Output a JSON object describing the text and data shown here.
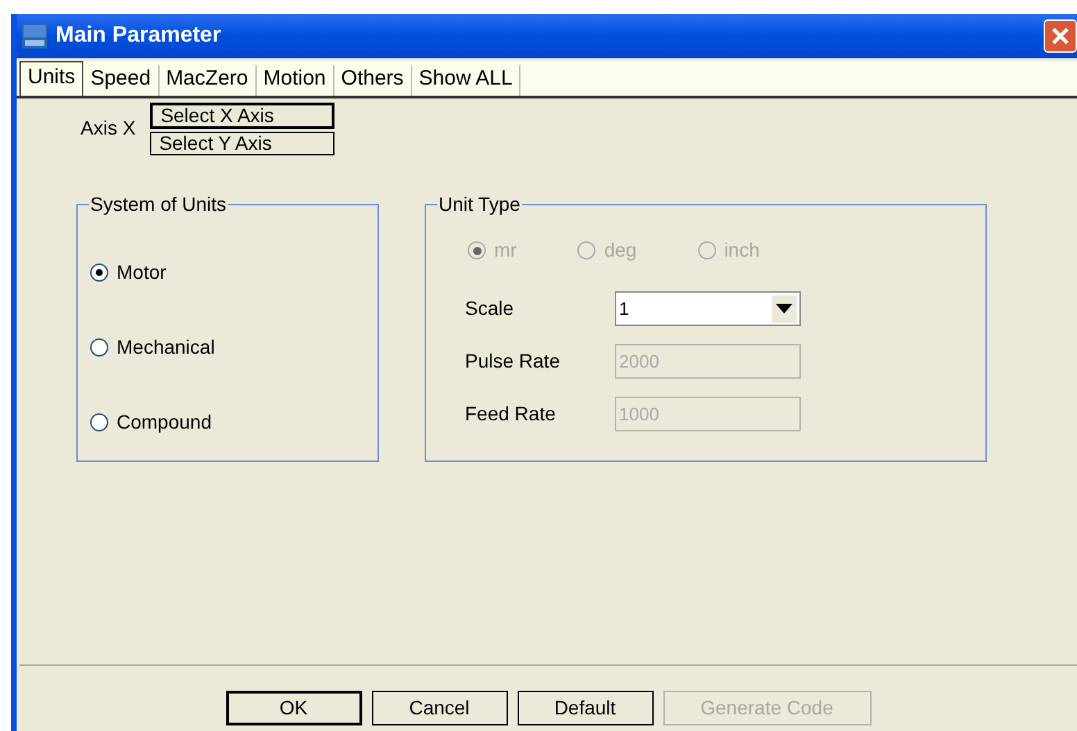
{
  "window": {
    "title": "Main Parameter"
  },
  "tabs": [
    {
      "label": "Units",
      "selected": true
    },
    {
      "label": "Speed",
      "selected": false
    },
    {
      "label": "MacZero",
      "selected": false
    },
    {
      "label": "Motion",
      "selected": false
    },
    {
      "label": "Others",
      "selected": false
    },
    {
      "label": "Show ALL",
      "selected": false
    }
  ],
  "axis": {
    "label": "Axis X",
    "buttons": [
      {
        "label": "Select X Axis",
        "focused": true
      },
      {
        "label": "Select Y Axis",
        "focused": false
      }
    ]
  },
  "system_of_units": {
    "title": "System of Units",
    "options": [
      {
        "label": "Motor",
        "selected": true
      },
      {
        "label": "Mechanical",
        "selected": false
      },
      {
        "label": "Compound",
        "selected": false
      }
    ]
  },
  "unit_type": {
    "title": "Unit Type",
    "disabled": true,
    "options": [
      {
        "label": "mr",
        "selected": true
      },
      {
        "label": "deg",
        "selected": false
      },
      {
        "label": "inch",
        "selected": false
      }
    ],
    "fields": [
      {
        "kind": "dropdown",
        "label": "Scale",
        "value": "1",
        "disabled": false
      },
      {
        "kind": "text",
        "label": "Pulse Rate",
        "value": "2000",
        "disabled": true
      },
      {
        "kind": "text",
        "label": "Feed Rate",
        "value": "1000",
        "disabled": true
      }
    ]
  },
  "buttons": [
    {
      "label": "OK",
      "default": true,
      "disabled": false
    },
    {
      "label": "Cancel",
      "default": false,
      "disabled": false
    },
    {
      "label": "Default",
      "default": false,
      "disabled": false
    },
    {
      "label": "Generate Code",
      "default": false,
      "disabled": true
    }
  ]
}
